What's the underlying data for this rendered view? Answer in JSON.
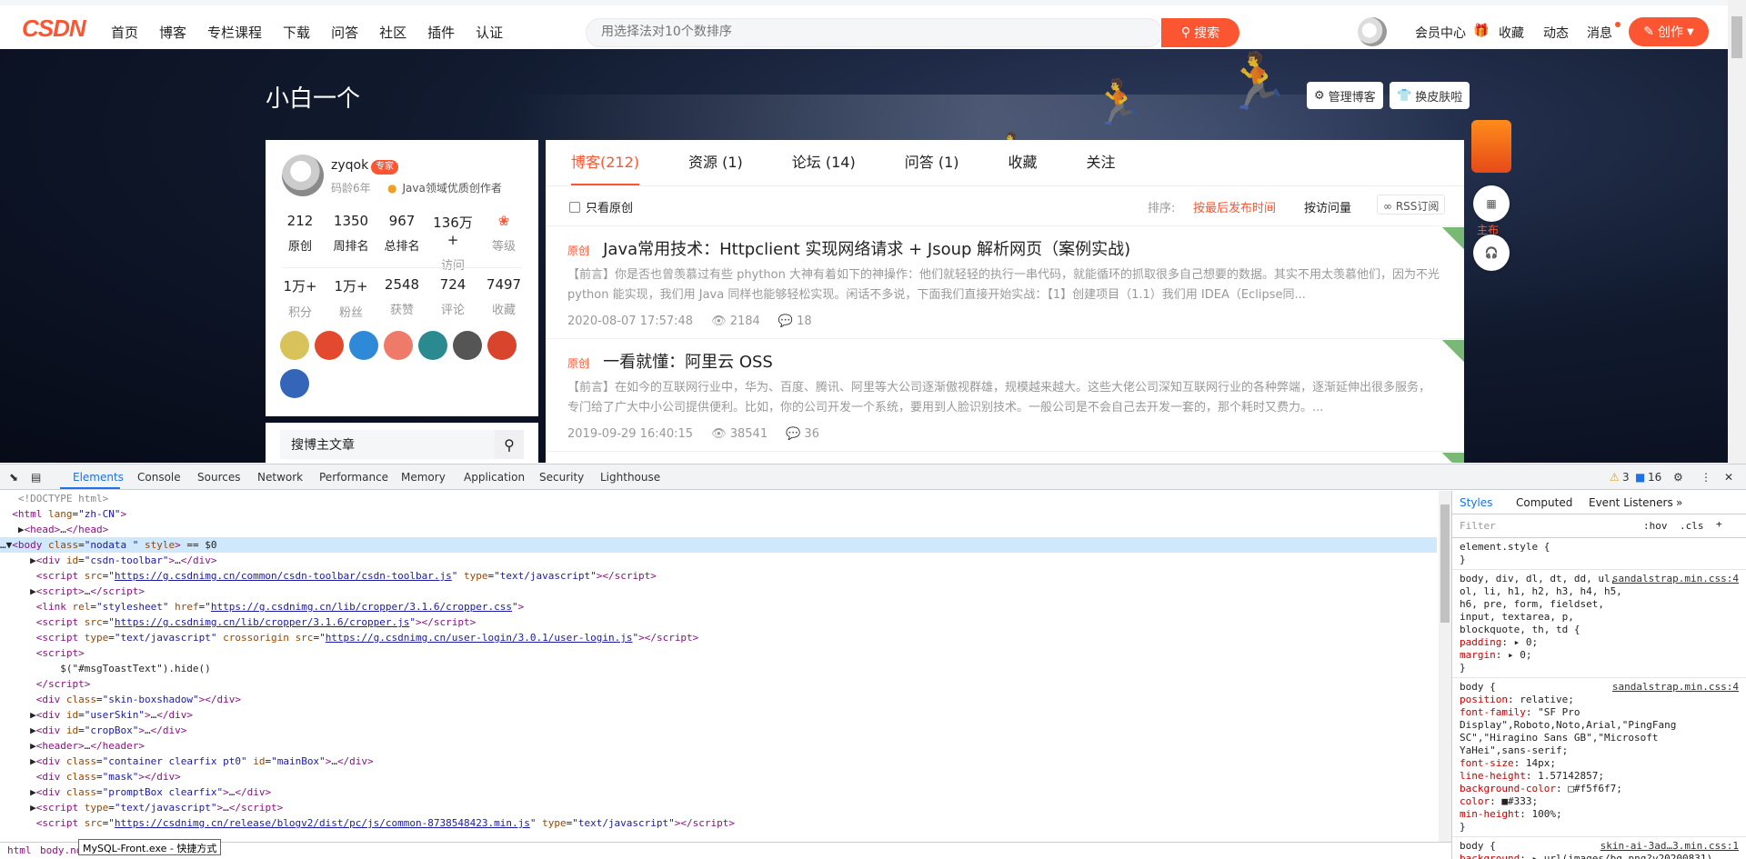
{
  "toolbar": {
    "logo_text": "CSDN",
    "nav": [
      "首页",
      "博客",
      "专栏课程",
      "下载",
      "问答",
      "社区",
      "插件",
      "认证"
    ],
    "search_placeholder": "用选择法对10个数排序",
    "search_button": "搜索",
    "vip": "会员中心",
    "favorites": "收藏",
    "dynamics": "动态",
    "messages": "消息",
    "create": "创作"
  },
  "banner": {
    "blog_title": "小白一个",
    "manage_button": "管理博客",
    "skin_button": "换皮肤啦"
  },
  "profile": {
    "username": "zyqok",
    "badge": "专家",
    "age": "码龄6年",
    "certification": "Java领域优质创作者",
    "stats_row1": [
      {
        "value": "212",
        "label": "原创"
      },
      {
        "value": "1350",
        "label": "周排名"
      },
      {
        "value": "967",
        "label": "总排名"
      },
      {
        "value": "136万+",
        "label": "访问"
      },
      {
        "value": "",
        "label": "等级"
      }
    ],
    "stats_row2": [
      {
        "value": "1万+",
        "label": "积分"
      },
      {
        "value": "1万+",
        "label": "粉丝"
      },
      {
        "value": "2548",
        "label": "获赞"
      },
      {
        "value": "724",
        "label": "评论"
      },
      {
        "value": "7497",
        "label": "收藏"
      }
    ],
    "search_placeholder": "搜博主文章"
  },
  "main": {
    "tabs": [
      "博客(212)",
      "资源 (1)",
      "论坛 (14)",
      "问答 (1)",
      "收藏",
      "关注"
    ],
    "only_original": "只看原创",
    "sort_label": "排序:",
    "sort_latest": "按最后发布时间",
    "sort_views": "按访问量",
    "rss": "RSS订阅",
    "articles": [
      {
        "tag": "原创",
        "title": "Java常用技术：Httpclient 实现网络请求 + Jsoup 解析网页（案例实战)",
        "summary": "【前言】你是否也曾羡慕过有些 phython 大神有着如下的神操作：他们就轻轻的执行一串代码，就能循环的抓取很多自己想要的数据。其实不用太羡慕他们，因为不光 python 能实现，我们用 Java 同样也能够轻松实现。闲话不多说，下面我们直接开始实战：【1】创建项目（1.1）我们用 IDEA（Eclipse同...",
        "date": "2020-08-07 17:57:48",
        "views": "2184",
        "comments": "18"
      },
      {
        "tag": "原创",
        "title": "一看就懂：阿里云 OSS",
        "summary": "【前言】在如今的互联网行业中，华为、百度、腾讯、阿里等大公司逐渐傲视群雄，规模越来越大。这些大佬公司深知互联网行业的各种弊端，逐渐延伸出很多服务，专门给了广大中小公司提供便利。比如，你的公司开发一个系统，要用到人脸识别技术。一般公司是不会自己去开发一套的，那个耗时又费力。...",
        "date": "2019-09-29 16:40:15",
        "views": "38541",
        "comments": "36"
      }
    ]
  },
  "float": {
    "label": "主布"
  },
  "devtools": {
    "tabs": [
      "Elements",
      "Console",
      "Sources",
      "Network",
      "Performance",
      "Memory",
      "Application",
      "Security",
      "Lighthouse"
    ],
    "warnings": "3",
    "messages": "16",
    "style_tabs": [
      "Styles",
      "Computed",
      "Event Listeners"
    ],
    "filter_placeholder": "Filter",
    "hov": ":hov",
    "cls": ".cls",
    "crumb_html": "html",
    "crumb_body": "body.no",
    "tooltip": "MySQL-Front.exe - 快捷方式",
    "styles": {
      "element_style": "element.style {",
      "rule1_sel": "body, div, dl, dt, dd, ul, ol, li, h1, h2, h3, h4, h5, h6, pre, form, fieldset, input, textarea, p, blockquote, th, td {",
      "rule1_src": "sandalstrap.min.css:4",
      "rule2_src": "sandalstrap.min.css:4",
      "rule3_src": "skin-ai-3ad…3.min.css:1"
    }
  }
}
